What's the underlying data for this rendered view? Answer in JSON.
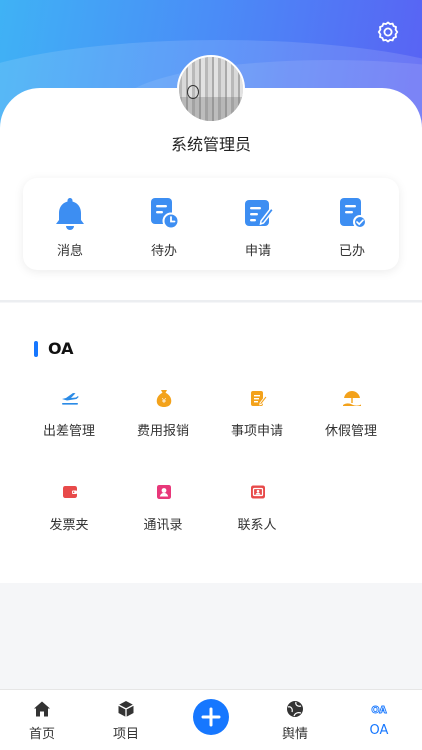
{
  "profile": {
    "name": "系统管理员"
  },
  "quick_actions": [
    {
      "label": "消息",
      "icon": "bell-icon"
    },
    {
      "label": "待办",
      "icon": "todo-clock-icon"
    },
    {
      "label": "申请",
      "icon": "apply-edit-icon"
    },
    {
      "label": "已办",
      "icon": "done-check-icon"
    }
  ],
  "oa": {
    "title": "OA",
    "items": [
      {
        "label": "出差管理",
        "icon": "plane-icon",
        "color": "#2b8be6"
      },
      {
        "label": "费用报销",
        "icon": "money-bag-icon",
        "color": "#f3a21b"
      },
      {
        "label": "事项申请",
        "icon": "clipboard-edit-icon",
        "color": "#f3a21b"
      },
      {
        "label": "休假管理",
        "icon": "beach-umbrella-icon",
        "color": "#f3a21b"
      },
      {
        "label": "发票夹",
        "icon": "wallet-icon",
        "color": "#e84a4a"
      },
      {
        "label": "通讯录",
        "icon": "contact-card-icon",
        "color": "#e8387a"
      },
      {
        "label": "联系人",
        "icon": "id-card-icon",
        "color": "#e84a4a"
      }
    ]
  },
  "tabbar": {
    "items": [
      {
        "label": "首页",
        "icon": "home-icon"
      },
      {
        "label": "项目",
        "icon": "cube-icon"
      },
      {
        "label": "舆情",
        "icon": "globe-icon"
      },
      {
        "label": "OA",
        "icon": "oa-icon"
      }
    ],
    "active_index": 3
  },
  "colors": {
    "accent": "#1677ff",
    "quick_icon": "#3d8ef2"
  }
}
